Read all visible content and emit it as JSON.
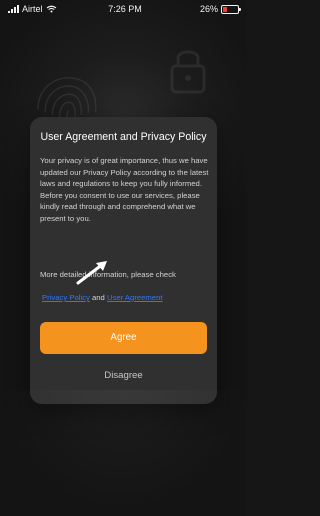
{
  "status_bar": {
    "carrier": "Airtel",
    "time": "7:26 PM",
    "battery": "26%"
  },
  "dialog": {
    "title": "User Agreement and Privacy Policy",
    "body": "Your privacy is of great importance, thus we have updated our Privacy Policy according to the latest laws and regulations to keep you fully informed.\nBefore you consent to use our services, please kindly read through and comprehend what we present to you.",
    "more_info": "More detailed information, please check",
    "privacy_link": "Privacy Policy",
    "and_text": "and",
    "user_agreement_link": "User Agreement",
    "agree_label": "Agree",
    "disagree_label": "Disagree"
  },
  "colors": {
    "accent": "#f4931d",
    "link": "#2b78ff",
    "dialog_bg": "#303030"
  },
  "icons": {
    "background_left": "fingerprint-icon",
    "background_right": "lock-icon",
    "signal": "signal-icon",
    "wifi": "wifi-icon",
    "battery": "battery-icon",
    "annotation": "arrow-icon"
  }
}
